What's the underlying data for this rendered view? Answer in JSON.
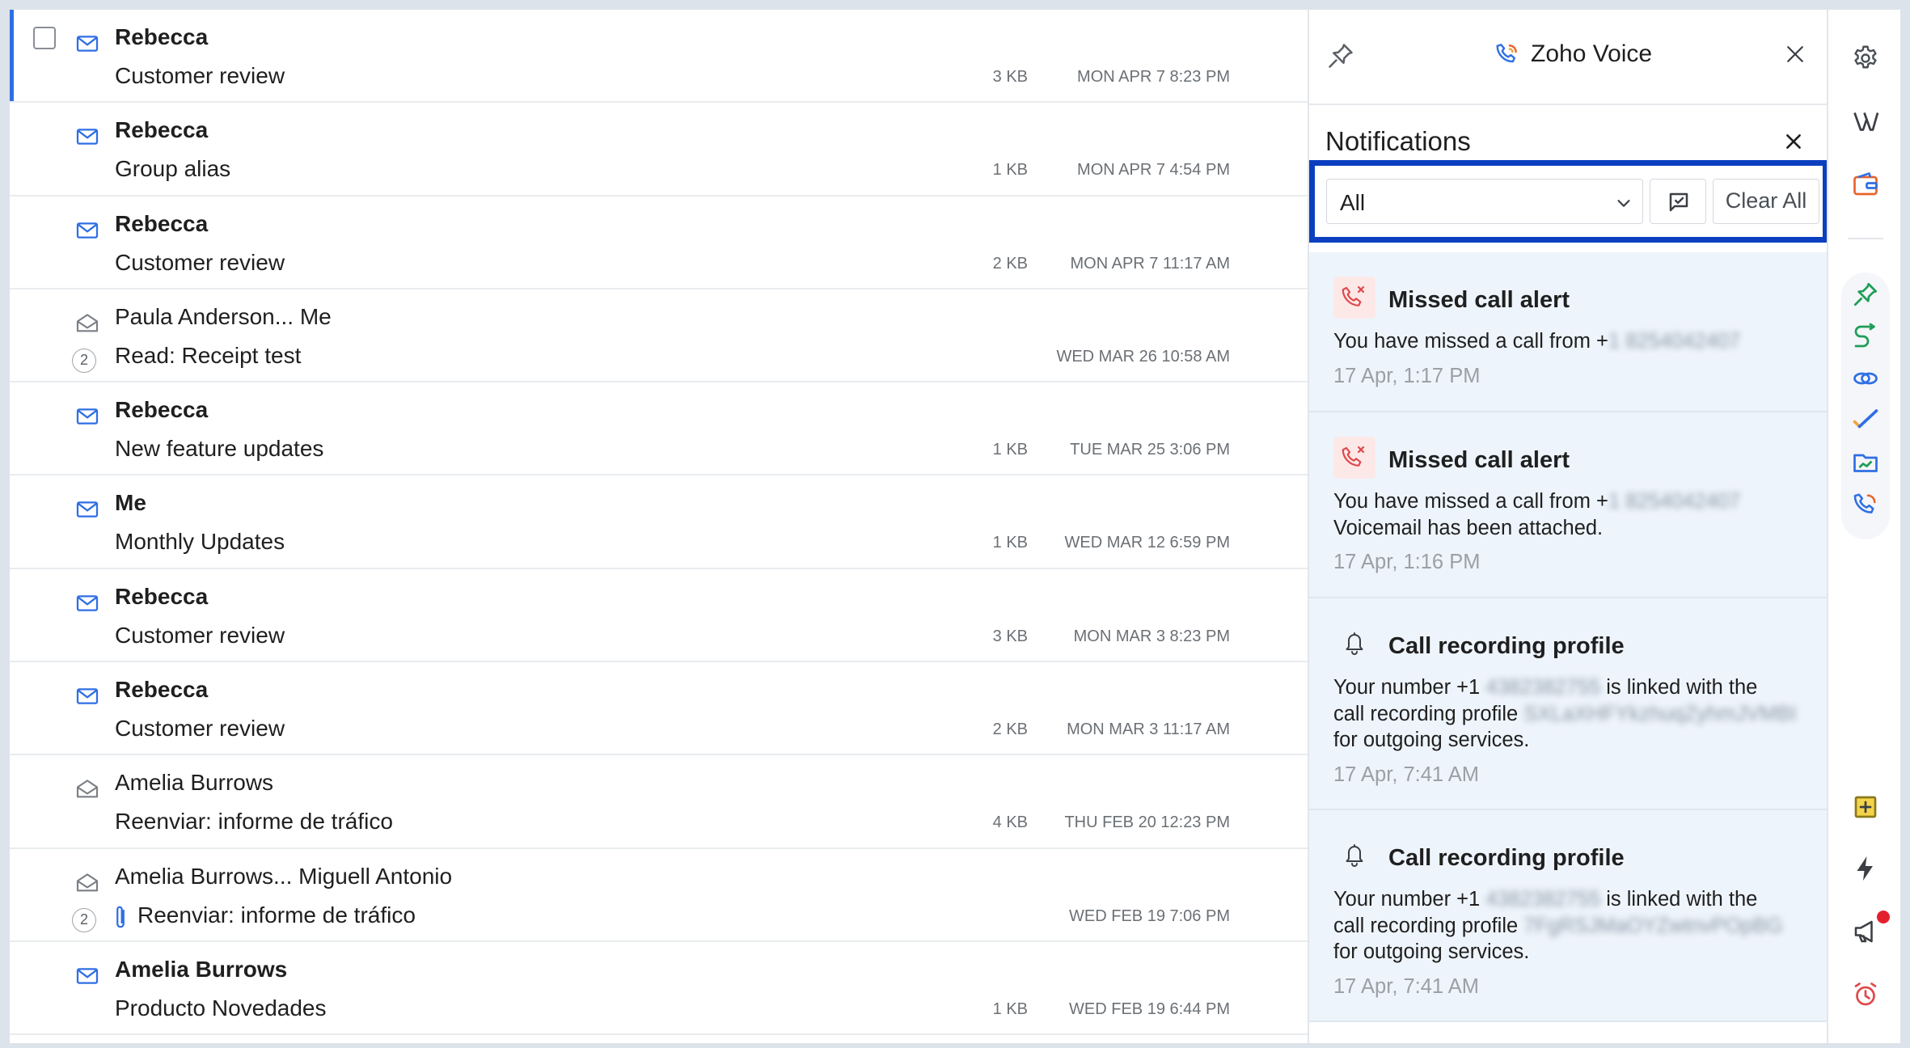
{
  "mail_list": {
    "rows": [
      {
        "sender": "Rebecca",
        "subject": "Customer review",
        "size": "3 KB",
        "date": "MON APR 7 8:23 PM",
        "unread": true,
        "selected": true,
        "count": "",
        "attachment": false
      },
      {
        "sender": "Rebecca",
        "subject": "Group alias",
        "size": "1 KB",
        "date": "MON APR 7 4:54 PM",
        "unread": true,
        "selected": false,
        "count": "",
        "attachment": false
      },
      {
        "sender": "Rebecca",
        "subject": "Customer review",
        "size": "2 KB",
        "date": "MON APR 7 11:17 AM",
        "unread": true,
        "selected": false,
        "count": "",
        "attachment": false
      },
      {
        "sender": "Paula Anderson... Me",
        "subject": "Read: Receipt test",
        "size": "",
        "date": "WED MAR 26 10:58 AM",
        "unread": false,
        "selected": false,
        "count": "2",
        "attachment": false
      },
      {
        "sender": "Rebecca",
        "subject": "New feature updates",
        "size": "1 KB",
        "date": "TUE MAR 25 3:06 PM",
        "unread": true,
        "selected": false,
        "count": "",
        "attachment": false
      },
      {
        "sender": "Me",
        "subject": "Monthly Updates",
        "size": "1 KB",
        "date": "WED MAR 12 6:59 PM",
        "unread": true,
        "selected": false,
        "count": "",
        "attachment": false
      },
      {
        "sender": "Rebecca",
        "subject": "Customer review",
        "size": "3 KB",
        "date": "MON MAR 3 8:23 PM",
        "unread": true,
        "selected": false,
        "count": "",
        "attachment": false
      },
      {
        "sender": "Rebecca",
        "subject": "Customer review",
        "size": "2 KB",
        "date": "MON MAR 3 11:17 AM",
        "unread": true,
        "selected": false,
        "count": "",
        "attachment": false
      },
      {
        "sender": "Amelia Burrows",
        "subject": "Reenviar: informe de tráfico",
        "size": "4 KB",
        "date": "THU FEB 20 12:23 PM",
        "unread": false,
        "selected": false,
        "count": "",
        "attachment": false
      },
      {
        "sender": "Amelia Burrows... Miguell Antonio",
        "subject": "Reenviar: informe de tráfico",
        "size": "",
        "date": "WED FEB 19 7:06 PM",
        "unread": false,
        "selected": false,
        "count": "2",
        "attachment": true
      },
      {
        "sender": "Amelia Burrows",
        "subject": "Producto Novedades",
        "size": "1 KB",
        "date": "WED FEB 19 6:44 PM",
        "unread": true,
        "selected": false,
        "count": "",
        "attachment": false
      }
    ]
  },
  "voice_panel": {
    "title": "Zoho Voice",
    "notifications_title": "Notifications",
    "filter_value": "All",
    "clear_all_label": "Clear All",
    "items": [
      {
        "type": "missed",
        "title": "Missed call alert",
        "lines": [
          [
            "You have missed a call from +",
            "1 8254042407"
          ]
        ],
        "time": "17 Apr, 1:17 PM"
      },
      {
        "type": "missed",
        "title": "Missed call alert",
        "lines": [
          [
            "You have missed a call from +",
            "1 8254042407"
          ],
          [
            "Voicemail has been attached.",
            ""
          ]
        ],
        "time": "17 Apr, 1:16 PM"
      },
      {
        "type": "bell",
        "title": "Call recording profile",
        "lines": [
          [
            "Your number +1 ",
            "4382382755",
            " is linked with the"
          ],
          [
            "call recording profile ",
            "SXLaXHFYkzhuqZyhmJVMBI"
          ],
          [
            "for outgoing services.",
            ""
          ]
        ],
        "time": "17 Apr, 7:41 AM"
      },
      {
        "type": "bell",
        "title": "Call recording profile",
        "lines": [
          [
            "Your number +1 ",
            "4382382755",
            " is linked with the"
          ],
          [
            "call recording profile ",
            "7FgRSJMaOYZwtnvPOpBG"
          ],
          [
            "for outgoing services.",
            ""
          ]
        ],
        "time": "17 Apr, 7:41 AM"
      }
    ]
  },
  "right_rail": {
    "icons": [
      "settings-icon",
      "zoho-vault-icon",
      "wallet-icon",
      "pin-extension-icon",
      "route-icon",
      "link-icon",
      "tasks-icon",
      "analytics-folder-icon",
      "voice-call-icon",
      "add-note-icon",
      "lightning-icon",
      "announcement-icon",
      "alarm-clock-icon"
    ]
  },
  "colors": {
    "accent": "#2f6fe4",
    "highlight_border": "#0b3fbf",
    "notification_bg": "#eef4fb",
    "missed_red": "#e0484a"
  }
}
